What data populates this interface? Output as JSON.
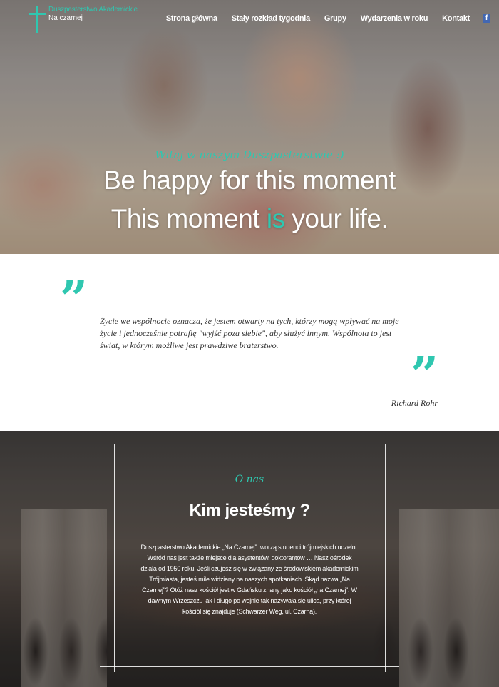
{
  "brand": {
    "title": "Duszpasterstwo Akademickie",
    "subtitle": "Na czarnej",
    "logo_icon": "cross-icon",
    "accent_color": "#2fc7b0"
  },
  "nav": {
    "items": [
      "Strona główna",
      "Stały rozkład tygodnia",
      "Grupy",
      "Wydarzenia w roku",
      "Kontakt"
    ],
    "social_icon": "facebook-icon",
    "social_glyph": "f"
  },
  "hero": {
    "welcome": "Witaj w naszym Duszpasterstwie :)",
    "line1": "Be happy for this moment",
    "line2_before": "This moment ",
    "line2_accent": "is",
    "line2_after": " your life."
  },
  "quote": {
    "open_mark": "”",
    "close_mark": "”",
    "text": "Życie we wspólnocie oznacza, że jestem otwarty na tych, którzy mogą wpływać na moje życie i jednocześnie potrafię \"wyjść poza siebie\", aby służyć innym. Wspólnota to jest świat, w którym możliwe jest prawdziwe braterstwo.",
    "author": "— Richard Rohr"
  },
  "about": {
    "kicker": "O nas",
    "title": "Kim jesteśmy ?",
    "text": "Duszpasterstwo Akademickie „Na Czarnej” tworzą studenci trójmiejskich uczelni. Wśród nas jest także miejsce dla asystentów, doktorantów … Nasz ośrodek działa od 1950 roku. Jeśli czujesz się w związany ze środowiskiem akademickim Trójmiasta, jesteś mile widziany na naszych spotkaniach. Skąd nazwa „Na Czarnej”? Otóż nasz kościół jest w Gdańsku znany jako kościół „na Czarnej”. W dawnym Wrzeszczu jak i długo po wojnie tak nazywała się ulica, przy której kościół się znajduje (Schwarzer Weg, ul. Czarna)."
  }
}
